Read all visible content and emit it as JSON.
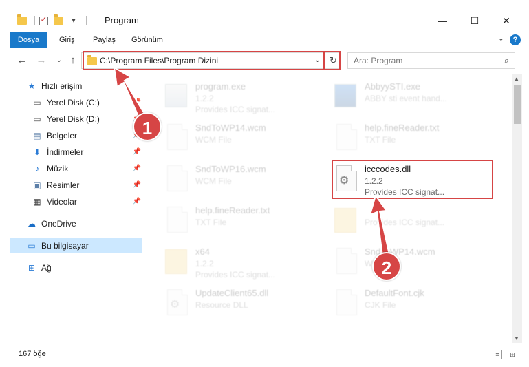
{
  "window": {
    "title": "Program",
    "minimize_label": "—",
    "maximize_label": "☐",
    "close_label": "✕"
  },
  "ribbon": {
    "tabs": [
      "Dosya",
      "Giriş",
      "Paylaş",
      "Görünüm"
    ],
    "help_label": "?"
  },
  "address": {
    "path": "C:\\Program Files\\Program Dizini"
  },
  "search": {
    "placeholder": "Ara: Program"
  },
  "sidebar": {
    "quick_access": "Hızlı erişim",
    "items": [
      "Yerel Disk (C:)",
      "Yerel Disk (D:)",
      "Belgeler",
      "İndirmeler",
      "Müzik",
      "Resimler",
      "Videolar"
    ],
    "onedrive": "OneDrive",
    "this_pc": "Bu bilgisayar",
    "network": "Ağ"
  },
  "files": [
    {
      "name": "program.exe",
      "line2": "1.2.2",
      "line3": "Provides ICC signat...",
      "icon": "exe-icon"
    },
    {
      "name": "AbbyySTI.exe",
      "line2": "ABBY sti event hand...",
      "line3": "",
      "icon": "exe-icon"
    },
    {
      "name": "SndToWP14.wcm",
      "line2": "WCM File",
      "line3": "",
      "icon": "file-icon"
    },
    {
      "name": "help.fineReader.txt",
      "line2": "TXT File",
      "line3": "",
      "icon": "file-icon"
    },
    {
      "name": "SndToWP16.wcm",
      "line2": "WCM File",
      "line3": "",
      "icon": "file-icon"
    },
    {
      "name": "icccodes.dll",
      "line2": "1.2.2",
      "line3": "Provides ICC signat...",
      "icon": "gear-file-icon"
    },
    {
      "name": "help.fineReader.txt",
      "line2": "TXT File",
      "line3": "",
      "icon": "file-icon"
    },
    {
      "name": "",
      "line2": "Provides ICC signat...",
      "line3": "",
      "icon": "folder-icon"
    },
    {
      "name": "x64",
      "line2": "1.2.2",
      "line3": "Provides ICC signat...",
      "icon": "folder-icon"
    },
    {
      "name": "SndToWP14.wcm",
      "line2": "W",
      "line3": "",
      "icon": "file-icon"
    },
    {
      "name": "UpdateClient65.dll",
      "line2": "Resource DLL",
      "line3": "",
      "icon": "gear-file-icon"
    },
    {
      "name": "DefaultFont.cjk",
      "line2": "CJK File",
      "line3": "",
      "icon": "file-icon"
    }
  ],
  "status": {
    "count": "167 öğe"
  },
  "annotations": {
    "badge1": "1",
    "badge2": "2",
    "color": "#d64545"
  }
}
